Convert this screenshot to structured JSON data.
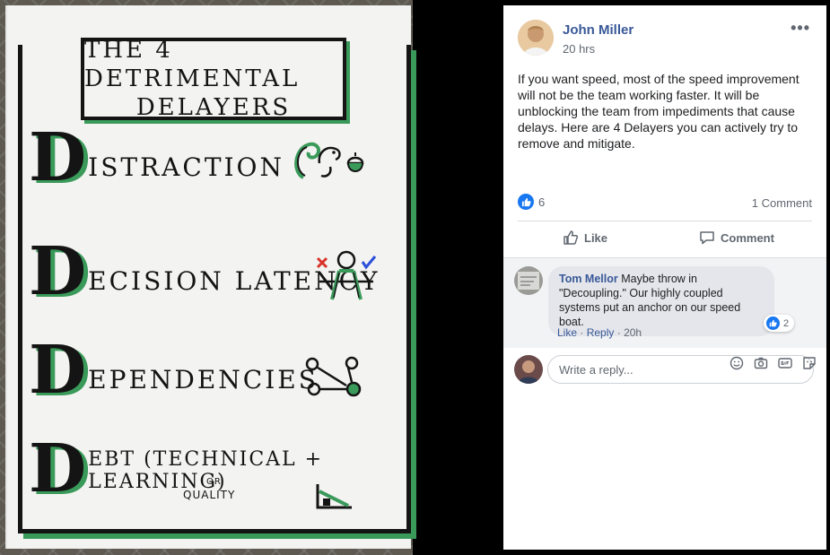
{
  "poster": {
    "title_line1": "THE 4 DETRIMENTAL",
    "title_line2": "DELAYERS",
    "items": [
      {
        "letter": "D",
        "rest": "ISTRACTION"
      },
      {
        "letter": "D",
        "rest": "ECISION LATENCY"
      },
      {
        "letter": "D",
        "rest": "EPENDENCIES"
      },
      {
        "letter": "D",
        "rest": "EBT (TECHNICAL + LEARNING)"
      }
    ],
    "debt_or": "OR",
    "debt_quality": "QUALITY"
  },
  "post": {
    "author": "John Miller",
    "time": "20 hrs",
    "text": "If you want speed, most of the speed improvement will not be the team working faster. It will be unblocking the team from impediments that cause delays. Here are 4 Delayers you can actively try to remove and mitigate.",
    "reaction_count": "6",
    "comment_count": "1 Comment",
    "like_label": "Like",
    "comment_label": "Comment"
  },
  "comment": {
    "author": "Tom Mellor",
    "text": "Maybe throw in \"Decoupling.\" Our highly coupled systems put an anchor on our speed boat.",
    "reaction_count": "2",
    "like_label": "Like",
    "reply_label": "Reply",
    "age": "20h"
  },
  "reply_box": {
    "placeholder": "Write a reply..."
  },
  "colors": {
    "link_blue": "#385898",
    "like_blue": "#1877f2",
    "marker_green": "#3a9a5a"
  }
}
